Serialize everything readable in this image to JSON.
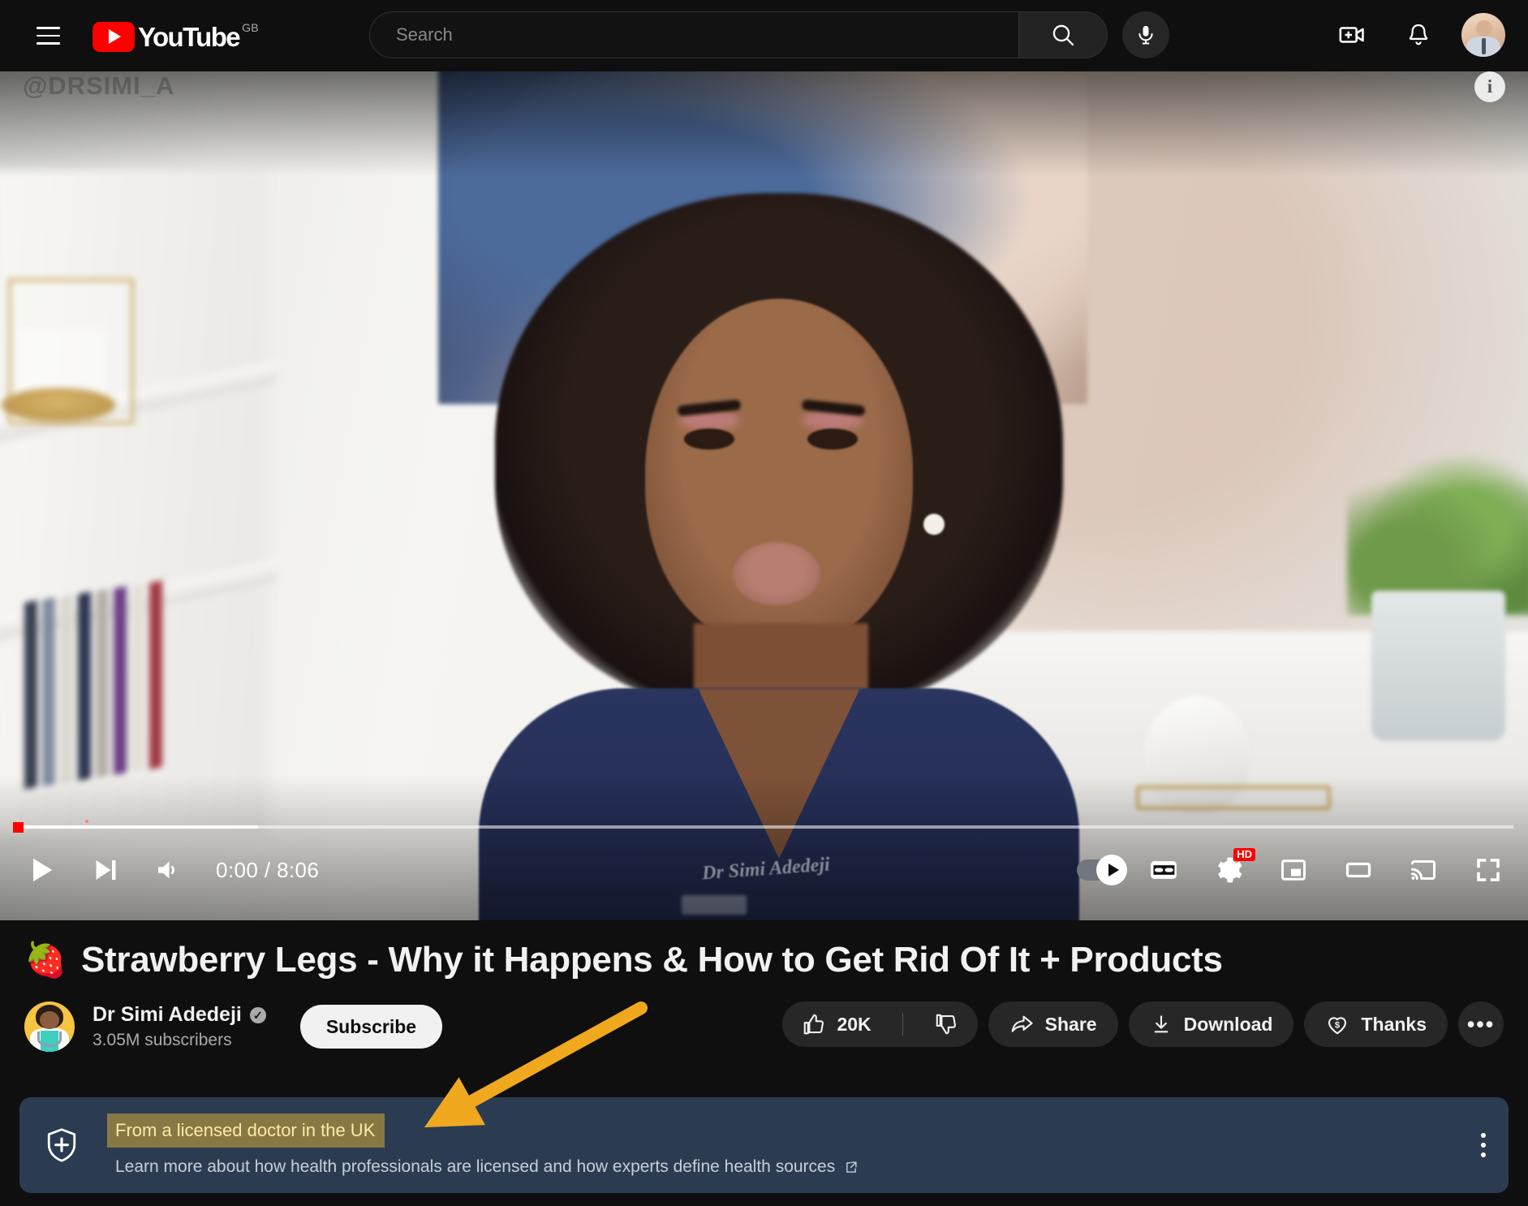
{
  "masthead": {
    "menu_icon": "hamburger-menu-icon",
    "logo_text": "YouTube",
    "logo_country": "GB",
    "search": {
      "placeholder": "Search",
      "value": "",
      "button_icon": "search-icon"
    },
    "mic_icon": "microphone-icon",
    "create_icon": "create-video-icon",
    "notifications_icon": "bell-icon",
    "avatar": "account-avatar"
  },
  "player": {
    "watermark": "@DRSIMI_A",
    "info_button": "i",
    "current_time": "0:00",
    "duration": "8:06",
    "time_display": "0:00 / 8:06",
    "progress_percent": 0,
    "buffered_percent": 15,
    "controls": {
      "play_icon": "play-icon",
      "next_icon": "next-video-icon",
      "volume_icon": "volume-icon",
      "autoplay_icon": "autoplay-toggle",
      "captions_icon": "closed-captions-icon",
      "settings_icon": "gear-icon",
      "settings_badge": "HD",
      "miniplayer_icon": "miniplayer-icon",
      "theater_icon": "theater-mode-icon",
      "cast_icon": "cast-icon",
      "fullscreen_icon": "fullscreen-icon"
    }
  },
  "video": {
    "emoji": "🍓",
    "title": "Strawberry Legs - Why it Happens & How to Get Rid Of It + Products",
    "channel": {
      "name": "Dr Simi Adedeji",
      "verified": true,
      "subscribers": "3.05M subscribers",
      "subscribe_label": "Subscribe"
    },
    "actions": {
      "like_count": "20K",
      "like_icon": "thumbs-up-icon",
      "dislike_icon": "thumbs-down-icon",
      "share_label": "Share",
      "share_icon": "share-icon",
      "download_label": "Download",
      "download_icon": "download-icon",
      "thanks_label": "Thanks",
      "thanks_icon": "heart-dollar-icon",
      "more_label": "•••"
    }
  },
  "info_banner": {
    "shield_icon": "health-shield-icon",
    "highlight_text": "From a licensed doctor in the UK",
    "sub_text": "Learn more about how health professionals are licensed and how experts define health sources",
    "external_link_icon": "external-link-icon",
    "menu_icon": "more-options-icon"
  },
  "annotation": {
    "arrow_color": "#f0a81e",
    "points_to": "From a licensed doctor in the UK"
  },
  "colors": {
    "background": "#0f0f0f",
    "brand_red": "#ff0000",
    "banner_bg": "#2b3c52",
    "highlight_bg": "#8a7334",
    "highlight_text": "#ffe9a8",
    "accent_arrow": "#f0a81e"
  }
}
